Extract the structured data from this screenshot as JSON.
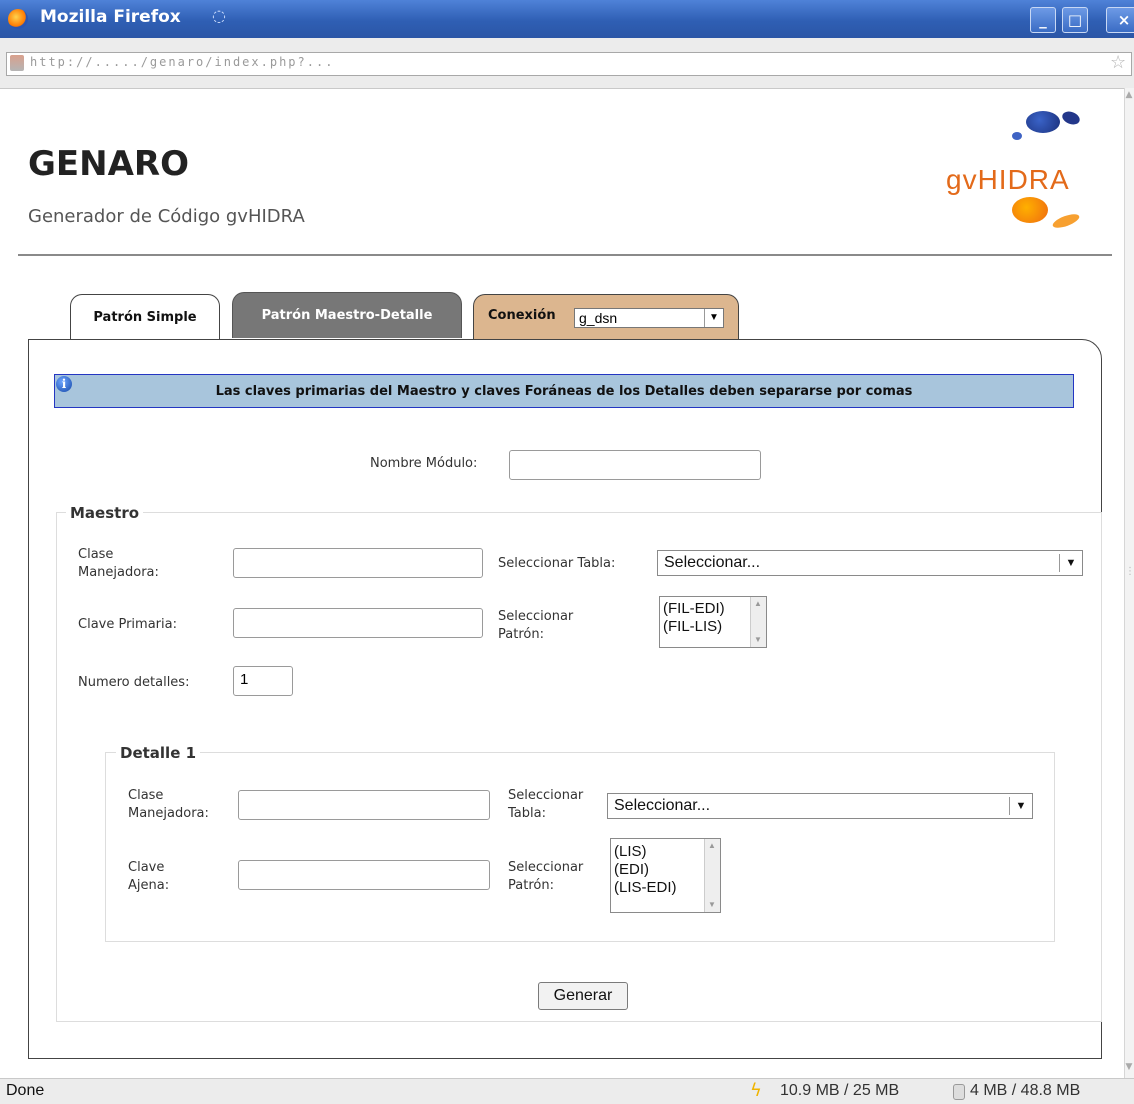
{
  "window": {
    "title": "Mozilla Firefox",
    "minimize": "_",
    "maximize": "□",
    "close": "×"
  },
  "browser": {
    "url_text": "http://...../genaro/index.php?...",
    "status": "Done",
    "memory_usage": "10.9 MB / 25 MB",
    "storage_usage": "4 MB / 48.8 MB"
  },
  "header": {
    "title": "GENARO",
    "subtitle": "Generador de Código gvHIDRA",
    "logo_text": "gvHIDRA"
  },
  "tabs": [
    {
      "label": "Patrón Simple",
      "active": false
    },
    {
      "label": "Patrón Maestro-Detalle",
      "active": true
    },
    {
      "label": "Conexión",
      "active": false
    }
  ],
  "conexion": {
    "selected": "g_dsn"
  },
  "info": {
    "icon": "info-icon",
    "message": "Las claves primarias del Maestro y claves Foráneas de los Detalles deben separarse por comas"
  },
  "form": {
    "nombre_modulo": {
      "label": "Nombre Módulo:",
      "value": ""
    },
    "maestro": {
      "legend": "Maestro",
      "clase_manejadora": {
        "label_line1": "Clase",
        "label_line2": "Manejadora:",
        "value": ""
      },
      "seleccionar_tabla": {
        "label": "Seleccionar Tabla:",
        "selected": "Seleccionar..."
      },
      "clave_primaria": {
        "label": "Clave Primaria:",
        "value": ""
      },
      "seleccionar_patron": {
        "label_line1": "Seleccionar",
        "label_line2": "Patrón:",
        "options": [
          "(FIL-EDI)",
          "(FIL-LIS)"
        ]
      },
      "numero_detalles": {
        "label": "Numero detalles:",
        "value": "1"
      }
    },
    "detalle": {
      "legend": "Detalle 1",
      "clase_manejadora": {
        "label_line1": "Clase",
        "label_line2": "Manejadora:",
        "value": ""
      },
      "seleccionar_tabla": {
        "label_line1": "Seleccionar",
        "label_line2": "Tabla:",
        "selected": "Seleccionar..."
      },
      "clave_ajena": {
        "label_line1": "Clave",
        "label_line2": "Ajena:",
        "value": ""
      },
      "seleccionar_patron": {
        "label_line1": "Seleccionar",
        "label_line2": "Patrón:",
        "options": [
          "(LIS)",
          "(EDI)",
          "(LIS-EDI)"
        ]
      }
    },
    "submit": "Generar"
  },
  "colors": {
    "title_bar": "#2f5fb4",
    "info_banner": "#a8c5dc",
    "info_border": "#2436c2",
    "active_tab": "#777777",
    "conexion_tab": "#dcb68f",
    "logo_orange": "#e36a1a",
    "logo_blue": "#1a2f7a"
  }
}
